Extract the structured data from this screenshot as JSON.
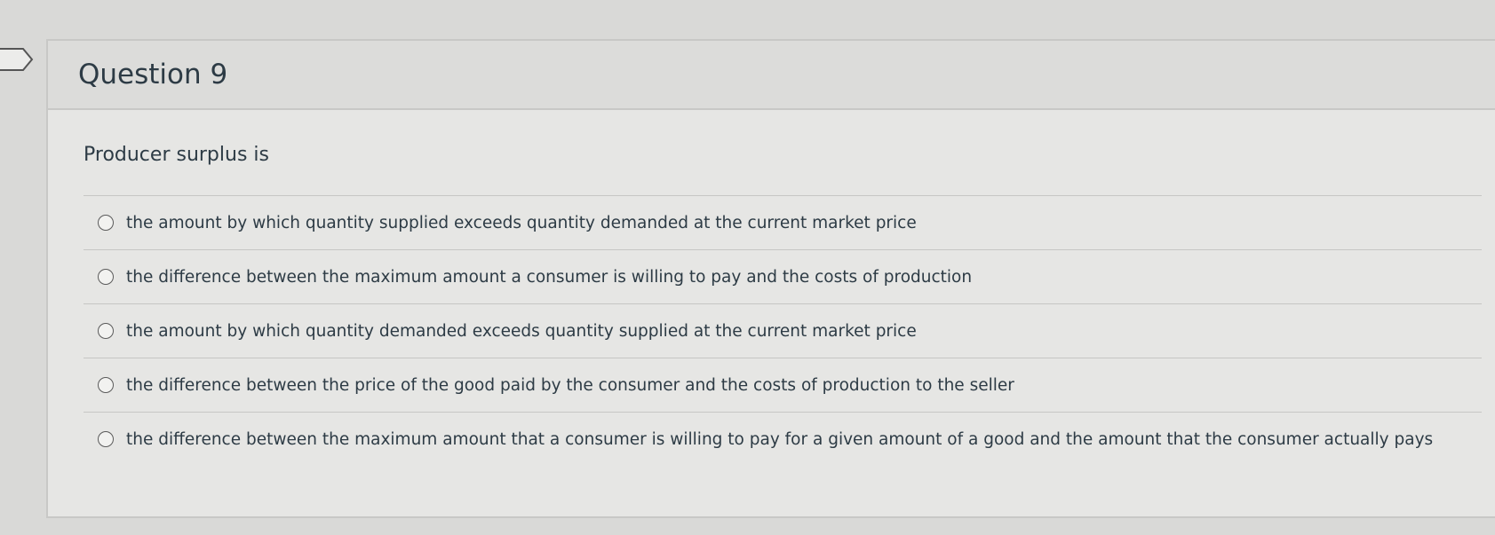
{
  "question": {
    "title": "Question 9",
    "prompt": "Producer surplus is",
    "answers": [
      {
        "label": "the amount by which quantity supplied exceeds quantity demanded at the current market price",
        "selected": false
      },
      {
        "label": "the difference between the maximum amount a consumer is willing to pay and the costs of production",
        "selected": false
      },
      {
        "label": "the amount by which quantity demanded exceeds quantity supplied at the current market price",
        "selected": false
      },
      {
        "label": "the difference between the price of the good paid by the consumer and the costs of production to the seller",
        "selected": false
      },
      {
        "label": "the difference between the maximum amount that a consumer is willing to pay for a given amount of a good and the amount that the consumer actually pays",
        "selected": false
      }
    ]
  },
  "icons": {
    "flag": "flag-icon"
  }
}
